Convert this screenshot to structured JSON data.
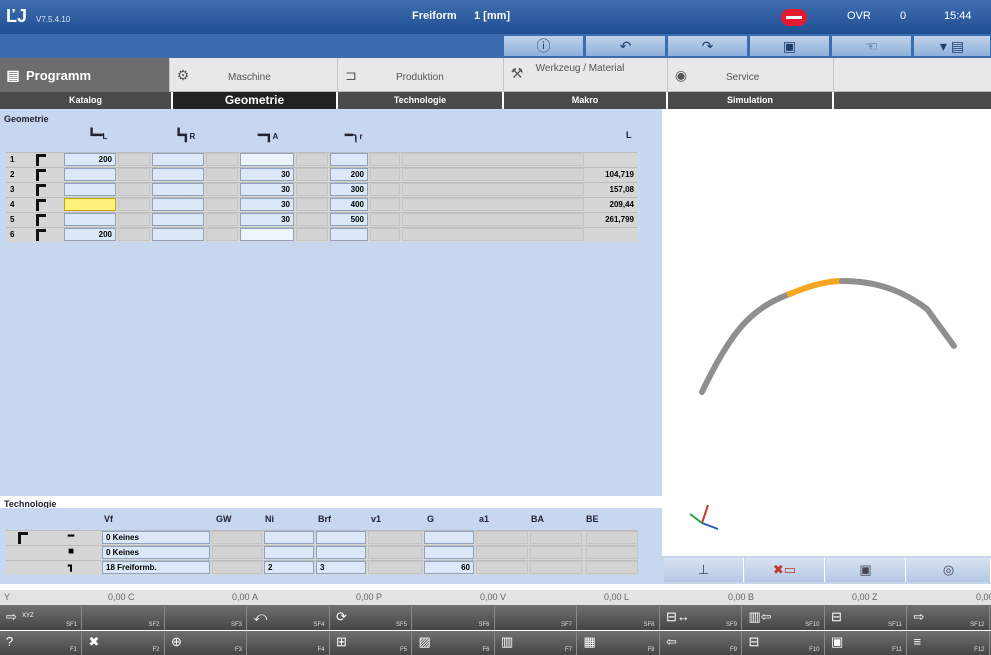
{
  "title_bar": {
    "logo": "ĽJ",
    "version": "V7.5.4.10",
    "mode": "Freiform",
    "unit": "1 [mm]",
    "ovr_label": "OVR",
    "ovr_value": "0",
    "time": "15:44"
  },
  "mode_tabs": [
    {
      "label": "Programm",
      "icon": "document-icon"
    },
    {
      "label": "Maschine",
      "icon": "gears-icon"
    },
    {
      "label": "Produktion",
      "icon": "bracket-icon"
    },
    {
      "label": "Werkzeug / Material",
      "icon": "wrench-icon"
    },
    {
      "label": "Service",
      "icon": "eye-icon"
    }
  ],
  "sub_tabs": [
    "Katalog",
    "Geometrie",
    "Technologie",
    "Makro",
    "Simulation"
  ],
  "geometry": {
    "section_label": "Geometrie",
    "headers": {
      "col1": "L",
      "col2": "R",
      "col3": "A",
      "col4": "r",
      "col5": "L"
    },
    "rows": [
      {
        "n": "1",
        "l": "200",
        "r": "",
        "a": "",
        "rr": "",
        "len": ""
      },
      {
        "n": "2",
        "l": "",
        "r": "",
        "a": "30",
        "rr": "200",
        "len": "104,719"
      },
      {
        "n": "3",
        "l": "",
        "r": "",
        "a": "30",
        "rr": "300",
        "len": "157,08"
      },
      {
        "n": "4",
        "l": "",
        "r": "",
        "a": "30",
        "rr": "400",
        "len": "209,44"
      },
      {
        "n": "5",
        "l": "",
        "r": "",
        "a": "30",
        "rr": "500",
        "len": "261,799"
      },
      {
        "n": "6",
        "l": "200",
        "r": "",
        "a": "",
        "rr": "",
        "len": ""
      }
    ]
  },
  "technology": {
    "section_label": "Technologie",
    "headers": [
      "Vf",
      "GW",
      "Ni",
      "Brf",
      "v1",
      "G",
      "a1",
      "BA",
      "BE"
    ],
    "rows": [
      {
        "vf": "0 Keines",
        "ni": "",
        "brf": "",
        "g": ""
      },
      {
        "vf": "0 Keines",
        "ni": "",
        "brf": "",
        "g": ""
      },
      {
        "vf": "18 Freiformb.",
        "ni": "2",
        "brf": "3",
        "g": "60"
      }
    ]
  },
  "positions": [
    {
      "axis": "Y",
      "value": "0,00"
    },
    {
      "axis": "C",
      "value": "0,00"
    },
    {
      "axis": "A",
      "value": "0,00"
    },
    {
      "axis": "P",
      "value": "0,00"
    },
    {
      "axis": "V",
      "value": "0,00"
    },
    {
      "axis": "L",
      "value": "0,00"
    },
    {
      "axis": "B",
      "value": "0,00"
    },
    {
      "axis": "Z",
      "value": "0,00"
    }
  ],
  "softkeys_row1": [
    "SF1",
    "SF2",
    "SF3",
    "SF4",
    "SF5",
    "SF6",
    "SF7",
    "SF8",
    "SF9",
    "SF10",
    "SF11",
    "SF12"
  ],
  "softkeys_row2": [
    "F1",
    "F2",
    "F3",
    "F4",
    "F5",
    "F6",
    "F7",
    "F8",
    "F9",
    "F10",
    "F11",
    "F12"
  ],
  "softkey_xyz_label": "XYZ",
  "colors": {
    "accent": "#2d5fa6",
    "panel": "#c6d7ef",
    "highlight": "#f39c12",
    "stop": "#e4192f"
  }
}
